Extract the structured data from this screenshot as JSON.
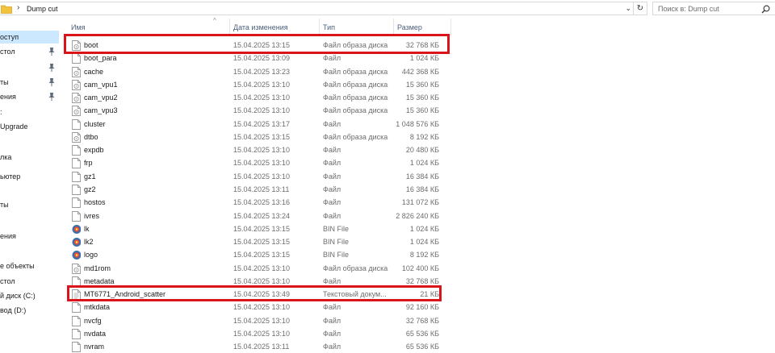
{
  "address_bar": {
    "separator": "›",
    "path": "Dump cut",
    "dropdown": "⌄",
    "refresh": "↻"
  },
  "search": {
    "placeholder": "Поиск в: Dump cut"
  },
  "nav": {
    "items": [
      {
        "label": "оступ",
        "selected": true,
        "pinned": false
      },
      {
        "label": "стол",
        "selected": false,
        "pinned": true
      },
      {
        "label": "",
        "selected": false,
        "pinned": true
      },
      {
        "label": "ты",
        "selected": false,
        "pinned": true
      },
      {
        "label": "ения",
        "selected": false,
        "pinned": true
      },
      {
        "label": ":",
        "selected": false,
        "pinned": false
      },
      {
        "label": "Upgrade",
        "selected": false,
        "pinned": false
      },
      {
        "label": "",
        "selected": false,
        "pinned": false
      },
      {
        "label": "лка",
        "selected": false,
        "pinned": false
      },
      {
        "label": "ьютер",
        "selected": false,
        "pinned": false
      },
      {
        "label": "",
        "selected": false,
        "pinned": false
      },
      {
        "label": "ты",
        "selected": false,
        "pinned": false
      },
      {
        "label": "",
        "selected": false,
        "pinned": false
      },
      {
        "label": "ения",
        "selected": false,
        "pinned": false
      },
      {
        "label": "",
        "selected": false,
        "pinned": false
      },
      {
        "label": "е объекты",
        "selected": false,
        "pinned": false
      },
      {
        "label": "стол",
        "selected": false,
        "pinned": false
      },
      {
        "label": "й диск (C:)",
        "selected": false,
        "pinned": false
      },
      {
        "label": "вод (D:)",
        "selected": false,
        "pinned": false
      }
    ]
  },
  "columns": {
    "name": "Имя",
    "date": "Дата изменения",
    "type": "Тип",
    "size": "Размер",
    "sort_indicator": "^"
  },
  "files": [
    {
      "name": "boot",
      "date": "15.04.2025 13:15",
      "type": "Файл образа диска",
      "size": "32 768 КБ",
      "icon": "disk-image-file-icon"
    },
    {
      "name": "boot_para",
      "date": "15.04.2025 13:09",
      "type": "Файл",
      "size": "1 024 КБ",
      "icon": "generic-file-icon"
    },
    {
      "name": "cache",
      "date": "15.04.2025 13:23",
      "type": "Файл образа диска",
      "size": "442 368 КБ",
      "icon": "disk-image-file-icon"
    },
    {
      "name": "cam_vpu1",
      "date": "15.04.2025 13:10",
      "type": "Файл образа диска",
      "size": "15 360 КБ",
      "icon": "disk-image-file-icon"
    },
    {
      "name": "cam_vpu2",
      "date": "15.04.2025 13:10",
      "type": "Файл образа диска",
      "size": "15 360 КБ",
      "icon": "disk-image-file-icon"
    },
    {
      "name": "cam_vpu3",
      "date": "15.04.2025 13:10",
      "type": "Файл образа диска",
      "size": "15 360 КБ",
      "icon": "disk-image-file-icon"
    },
    {
      "name": "cluster",
      "date": "15.04.2025 13:17",
      "type": "Файл",
      "size": "1 048 576 КБ",
      "icon": "generic-file-icon"
    },
    {
      "name": "dtbo",
      "date": "15.04.2025 13:15",
      "type": "Файл образа диска",
      "size": "8 192 КБ",
      "icon": "disk-image-file-icon"
    },
    {
      "name": "expdb",
      "date": "15.04.2025 13:10",
      "type": "Файл",
      "size": "20 480 КБ",
      "icon": "generic-file-icon"
    },
    {
      "name": "frp",
      "date": "15.04.2025 13:10",
      "type": "Файл",
      "size": "1 024 КБ",
      "icon": "generic-file-icon"
    },
    {
      "name": "gz1",
      "date": "15.04.2025 13:10",
      "type": "Файл",
      "size": "16 384 КБ",
      "icon": "generic-file-icon"
    },
    {
      "name": "gz2",
      "date": "15.04.2025 13:11",
      "type": "Файл",
      "size": "16 384 КБ",
      "icon": "generic-file-icon"
    },
    {
      "name": "hostos",
      "date": "15.04.2025 13:16",
      "type": "Файл",
      "size": "131 072 КБ",
      "icon": "generic-file-icon"
    },
    {
      "name": "ivres",
      "date": "15.04.2025 13:24",
      "type": "Файл",
      "size": "2 826 240 КБ",
      "icon": "generic-file-icon"
    },
    {
      "name": "lk",
      "date": "15.04.2025 13:15",
      "type": "BIN File",
      "size": "1 024 КБ",
      "icon": "bin-file-icon"
    },
    {
      "name": "lk2",
      "date": "15.04.2025 13:15",
      "type": "BIN File",
      "size": "1 024 КБ",
      "icon": "bin-file-icon"
    },
    {
      "name": "logo",
      "date": "15.04.2025 13:15",
      "type": "BIN File",
      "size": "8 192 КБ",
      "icon": "bin-file-icon"
    },
    {
      "name": "md1rom",
      "date": "15.04.2025 13:10",
      "type": "Файл образа диска",
      "size": "102 400 КБ",
      "icon": "disk-image-file-icon"
    },
    {
      "name": "metadata",
      "date": "15.04.2025 13:10",
      "type": "Файл",
      "size": "32 768 КБ",
      "icon": "generic-file-icon"
    },
    {
      "name": "MT6771_Android_scatter",
      "date": "15.04.2025 13:49",
      "type": "Текстовый докум...",
      "size": "21 КБ",
      "icon": "text-document-icon"
    },
    {
      "name": "mtkdata",
      "date": "15.04.2025 13:10",
      "type": "Файл",
      "size": "92 160 КБ",
      "icon": "generic-file-icon"
    },
    {
      "name": "nvcfg",
      "date": "15.04.2025 13:10",
      "type": "Файл",
      "size": "32 768 КБ",
      "icon": "generic-file-icon"
    },
    {
      "name": "nvdata",
      "date": "15.04.2025 13:10",
      "type": "Файл",
      "size": "65 536 КБ",
      "icon": "generic-file-icon"
    },
    {
      "name": "nvram",
      "date": "15.04.2025 13:11",
      "type": "Файл",
      "size": "65 536 КБ",
      "icon": "generic-file-icon"
    }
  ],
  "highlighted_files": [
    "boot",
    "MT6771_Android_scatter"
  ],
  "colors": {
    "highlight": "#d9141b",
    "nav_selected": "#cce8ff",
    "header_text": "#4c607a",
    "folder": "#f4c33d"
  }
}
